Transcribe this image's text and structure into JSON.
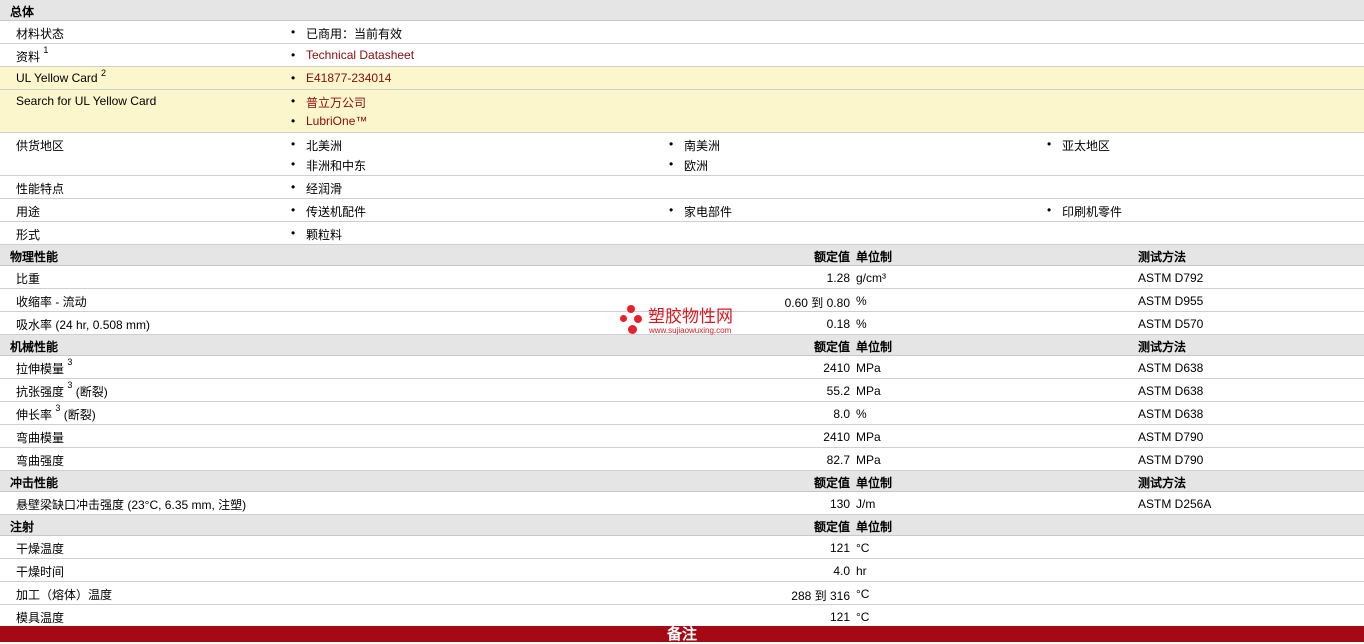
{
  "general": {
    "title": "总体",
    "material_status": {
      "label": "材料状态",
      "value": "已商用：当前有效"
    },
    "docs": {
      "label": "资料",
      "sup": "1",
      "link": "Technical Datasheet"
    },
    "ul_card": {
      "label": "UL Yellow Card",
      "sup": "2",
      "link": "E41877-234014"
    },
    "ul_search": {
      "label": "Search for UL Yellow Card",
      "links": [
        "普立万公司",
        "LubriOne™"
      ]
    },
    "regions": {
      "label": "供货地区",
      "items": [
        "北美洲",
        "南美洲",
        "亚太地区",
        "非洲和中东",
        "欧洲"
      ]
    },
    "features": {
      "label": "性能特点",
      "items": [
        "经润滑"
      ]
    },
    "uses": {
      "label": "用途",
      "items": [
        "传送机配件",
        "家电部件",
        "印刷机零件"
      ]
    },
    "form": {
      "label": "形式",
      "items": [
        "颗粒料"
      ]
    }
  },
  "headers": {
    "value": "额定值",
    "unit": "单位制",
    "method": "测试方法"
  },
  "physical": {
    "title": "物理性能",
    "rows": [
      {
        "label": "比重",
        "value": "1.28",
        "unit": "g/cm³",
        "method": "ASTM D792"
      },
      {
        "label": "收缩率  - 流动",
        "value": "0.60 到  0.80",
        "unit": "%",
        "method": "ASTM D955"
      },
      {
        "label": "吸水率  (24 hr, 0.508 mm)",
        "value": "0.18",
        "unit": "%",
        "method": "ASTM D570"
      }
    ]
  },
  "mechanical": {
    "title": "机械性能",
    "rows": [
      {
        "label": "拉伸模量",
        "sup": "3",
        "suffix": "",
        "value": "2410",
        "unit": "MPa",
        "method": "ASTM D638"
      },
      {
        "label": "抗张强度",
        "sup": "3",
        "suffix": " (断裂)",
        "value": "55.2",
        "unit": "MPa",
        "method": "ASTM D638"
      },
      {
        "label": "伸长率",
        "sup": "3",
        "suffix": " (断裂)",
        "value": "8.0",
        "unit": "%",
        "method": "ASTM D638"
      },
      {
        "label": "弯曲模量",
        "sup": "",
        "suffix": "",
        "value": "2410",
        "unit": "MPa",
        "method": "ASTM D790"
      },
      {
        "label": "弯曲强度",
        "sup": "",
        "suffix": "",
        "value": "82.7",
        "unit": "MPa",
        "method": "ASTM D790"
      }
    ]
  },
  "impact": {
    "title": "冲击性能",
    "rows": [
      {
        "label": "悬壁梁缺口冲击强度  (23°C, 6.35 mm, 注塑)",
        "value": "130",
        "unit": "J/m",
        "method": "ASTM D256A"
      }
    ]
  },
  "injection": {
    "title": "注射",
    "rows": [
      {
        "label": "干燥温度",
        "value": "121",
        "unit": "°C"
      },
      {
        "label": "干燥时间",
        "value": "4.0",
        "unit": "hr"
      },
      {
        "label": "加工（熔体）温度",
        "value": "288 到  316",
        "unit": "°C"
      },
      {
        "label": "模具温度",
        "value": "121",
        "unit": "°C"
      }
    ]
  },
  "footer": {
    "label": "备注"
  },
  "watermark": {
    "title": "塑胶物性网",
    "url": "www.sujiaowuxing.com"
  }
}
